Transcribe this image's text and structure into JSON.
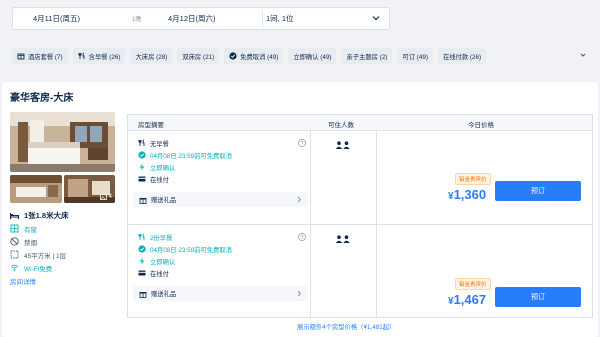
{
  "search": {
    "checkin": "4月11日(周五)",
    "nights": "1晚",
    "checkout": "4月12日(周六)",
    "guests": "1间, 1位"
  },
  "filters": [
    {
      "icon": "package-icon",
      "label": "酒店套餐 (7)"
    },
    {
      "icon": "breakfast-icon",
      "label": "含早餐 (26)"
    },
    {
      "icon": "",
      "label": "大床房 (28)"
    },
    {
      "icon": "",
      "label": "双床房 (21)"
    },
    {
      "icon": "check-circle-icon",
      "label": "免费取消 (49)"
    },
    {
      "icon": "",
      "label": "立即确认 (49)"
    },
    {
      "icon": "",
      "label": "亲子主题房 (2)"
    },
    {
      "icon": "",
      "label": "可订 (49)"
    },
    {
      "icon": "",
      "label": "在线付款 (26)"
    }
  ],
  "room": {
    "title": "豪华客房-大床",
    "photo_count": "4",
    "bed": "1张1.8米大床",
    "window": "有窗",
    "smoking": "禁烟",
    "area": "45平方米 | 1层",
    "wifi": "Wi-Fi免费",
    "details_link": "房间详情"
  },
  "table": {
    "headers": {
      "summary": "房型摘要",
      "occupancy": "可住人数",
      "price": "今日价格"
    },
    "plans": [
      {
        "meal": "无早餐",
        "cancel": "04月08日 23:59前可免费取消",
        "confirm": "立即确认",
        "payment": "在线付",
        "gift": "赠送礼品",
        "tag": "铂金贵宾价",
        "currency": "¥",
        "price": "1,360",
        "book": "预订"
      },
      {
        "meal": "2份早餐",
        "cancel": "04月08日 23:59前可免费取消",
        "confirm": "立即确认",
        "payment": "在线付",
        "gift": "赠送礼品",
        "tag": "铂金贵宾价",
        "currency": "¥",
        "price": "1,467",
        "book": "预订"
      }
    ]
  },
  "more_link": "展示额外4个房型价格（¥1,481起）",
  "colors": {
    "accent": "#287dfa",
    "green": "#06aebd",
    "text": "#0f294d",
    "tag": "#ff6f00"
  }
}
